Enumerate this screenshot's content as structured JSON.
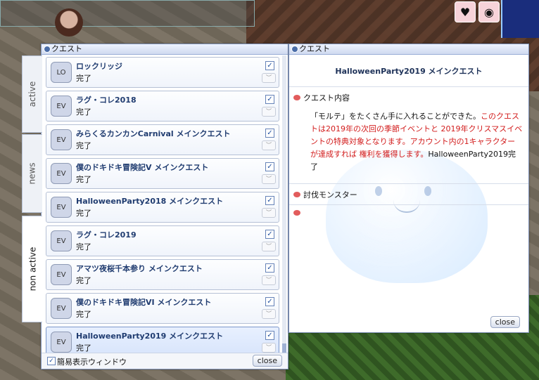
{
  "left_window": {
    "title": "クエスト",
    "tabs": [
      "active",
      "news",
      "non active"
    ],
    "quests": [
      {
        "name": "ロックリッジ",
        "status": "完了",
        "icon": "LO",
        "checked": true
      },
      {
        "name": "ラグ・コレ2018",
        "status": "完了",
        "icon": "EV",
        "checked": true
      },
      {
        "name": "みらくるカンカンCarnival メインクエスト",
        "status": "完了",
        "icon": "EV",
        "checked": true
      },
      {
        "name": "僕のドキドキ冒険記V メインクエスト",
        "status": "完了",
        "icon": "EV",
        "checked": true
      },
      {
        "name": "HalloweenParty2018 メインクエスト",
        "status": "完了",
        "icon": "EV",
        "checked": true
      },
      {
        "name": "ラグ・コレ2019",
        "status": "完了",
        "icon": "EV",
        "checked": true
      },
      {
        "name": "アマツ夜桜千本参り メインクエスト",
        "status": "完了",
        "icon": "EV",
        "checked": true
      },
      {
        "name": "僕のドキドキ冒険記VI メインクエスト",
        "status": "完了",
        "icon": "EV",
        "checked": true
      },
      {
        "name": "HalloweenParty2019 メインクエスト",
        "status": "完了",
        "icon": "EV",
        "checked": true
      }
    ],
    "simple_display_label": "簡易表示ウィンドウ",
    "simple_display_checked": true,
    "close_label": "close"
  },
  "right_window": {
    "title": "クエスト",
    "quest_title": "HalloweenParty2019 メインクエスト",
    "content_header": "クエスト内容",
    "desc_black_1": "「モルテ」をたくさん手に入れることができた。",
    "desc_red": "このクエストは2019年の次回の季節イベントと 2019年クリスマスイベントの特典対象となります。アカウント内の1キャラクターが達成すれば 権利を獲得します。",
    "desc_black_2": "HalloweenParty2019完了",
    "monster_header": "討伐モンスター",
    "close_label": "close"
  },
  "colors": {
    "accent": "#203c70",
    "red_text": "#d21b1b"
  }
}
